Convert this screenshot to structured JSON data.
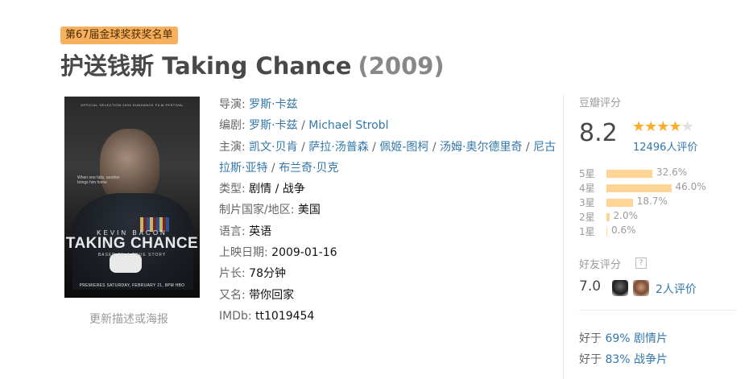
{
  "award_badge": "第67届金球奖获奖名单",
  "title": {
    "main": "护送钱斯 Taking Chance",
    "year": "(2009)"
  },
  "poster": {
    "top_text": "OFFICIAL SELECTION 2009 SUNDANCE FILM FESTIVAL",
    "tagline": "When one falls, another brings him home",
    "actor": "KEVIN BACON",
    "title": "TAKING CHANCE",
    "subtitle": "BASED ON A TRUE STORY",
    "premiere": "PREMIERES SATURDAY, FEBRUARY 21, 8PM HBO"
  },
  "update_link": "更新描述或海报",
  "info": {
    "director_label": "导演",
    "director": "罗斯·卡兹",
    "writer_label": "编剧",
    "writers": [
      "罗斯·卡兹",
      "Michael Strobl"
    ],
    "cast_label": "主演",
    "cast": [
      "凯文·贝肯",
      "萨拉·汤普森",
      "佩姬-图柯",
      "汤姆·奥尔德里奇",
      "尼古拉斯·亚特",
      "布兰奇·贝克"
    ],
    "genre_label": "类型:",
    "genres": [
      "剧情",
      "战争"
    ],
    "country_label": "制片国家/地区:",
    "country": "美国",
    "language_label": "语言:",
    "language": "英语",
    "release_label": "上映日期:",
    "release": "2009-01-16",
    "runtime_label": "片长:",
    "runtime": "78分钟",
    "aka_label": "又名:",
    "aka": "带你回家",
    "imdb_label": "IMDb:",
    "imdb": "tt1019454"
  },
  "rating": {
    "label": "豆瓣评分",
    "score": "8.2",
    "stars": 4,
    "star_max": 5,
    "count_text": "12496人评价",
    "star_color": "#ffac2d",
    "bar_color": "#ffd596",
    "distribution": [
      {
        "label": "5星",
        "percent_text": "32.6%",
        "percent": 32.6
      },
      {
        "label": "4星",
        "percent_text": "46.0%",
        "percent": 46.0
      },
      {
        "label": "3星",
        "percent_text": "18.7%",
        "percent": 18.7
      },
      {
        "label": "2星",
        "percent_text": "2.0%",
        "percent": 2.0
      },
      {
        "label": "1星",
        "percent_text": "0.6%",
        "percent": 0.6
      }
    ]
  },
  "friends": {
    "label": "好友评分",
    "help": "?",
    "score": "7.0",
    "count_text": "2人评价"
  },
  "better_than": [
    {
      "prefix": "好于",
      "percent": "69%",
      "genre": "剧情片"
    },
    {
      "prefix": "好于",
      "percent": "83%",
      "genre": "战争片"
    }
  ]
}
